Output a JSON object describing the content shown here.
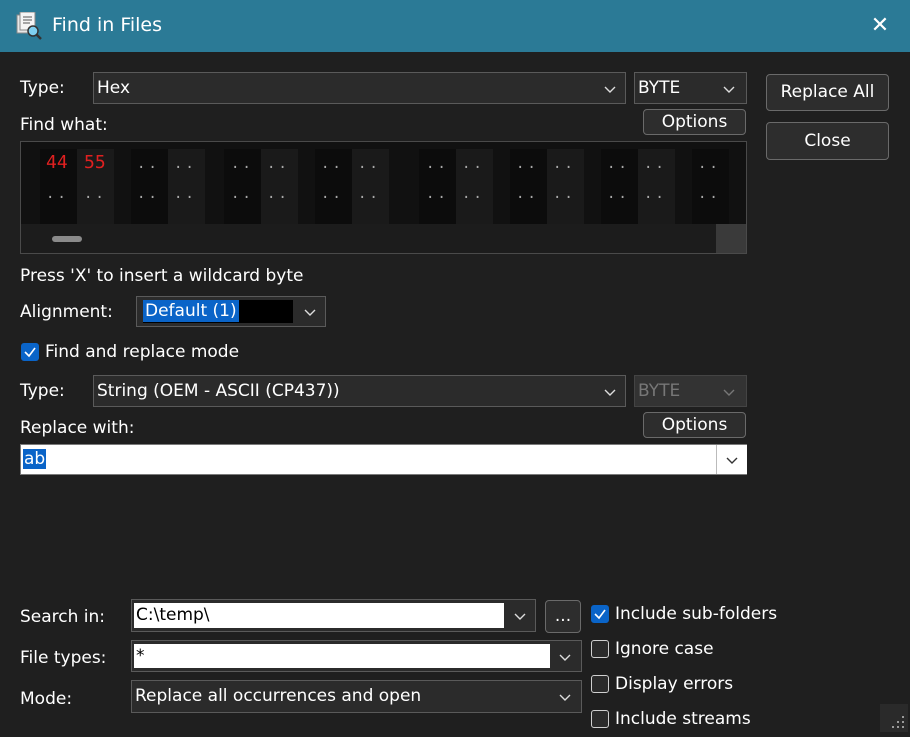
{
  "window": {
    "title": "Find in Files",
    "close_glyph": "✕"
  },
  "find": {
    "type_label": "Type:",
    "type_value": "Hex",
    "width_value": "BYTE",
    "what_label": "Find what:",
    "options_label": "Options",
    "hex_values": [
      "44",
      "55"
    ],
    "wildcard_hint": "Press 'X' to insert a wildcard byte"
  },
  "alignment": {
    "label": "Alignment:",
    "value": "Default (1)"
  },
  "replace_mode": {
    "label": "Find and replace mode",
    "checked": true
  },
  "replace": {
    "type_label": "Type:",
    "type_value": "String (OEM - ASCII (CP437))",
    "width_value": "BYTE",
    "with_label": "Replace with:",
    "options_label": "Options",
    "value": "ab"
  },
  "buttons": {
    "replace_all": "Replace All",
    "close": "Close"
  },
  "search": {
    "in_label": "Search in:",
    "in_value": "C:\\temp\\",
    "browse_label": "...",
    "types_label": "File types:",
    "types_value": "*",
    "mode_label": "Mode:",
    "mode_value": "Replace all occurrences and open"
  },
  "options": [
    {
      "label": "Include sub-folders",
      "checked": true
    },
    {
      "label": "Ignore case",
      "checked": false
    },
    {
      "label": "Display errors",
      "checked": false
    },
    {
      "label": "Include streams",
      "checked": false
    }
  ],
  "colors": {
    "titlebar": "#2b7a96",
    "accent": "#0a64c8",
    "hex_value": "#e02020",
    "background": "#1f1f1f"
  }
}
